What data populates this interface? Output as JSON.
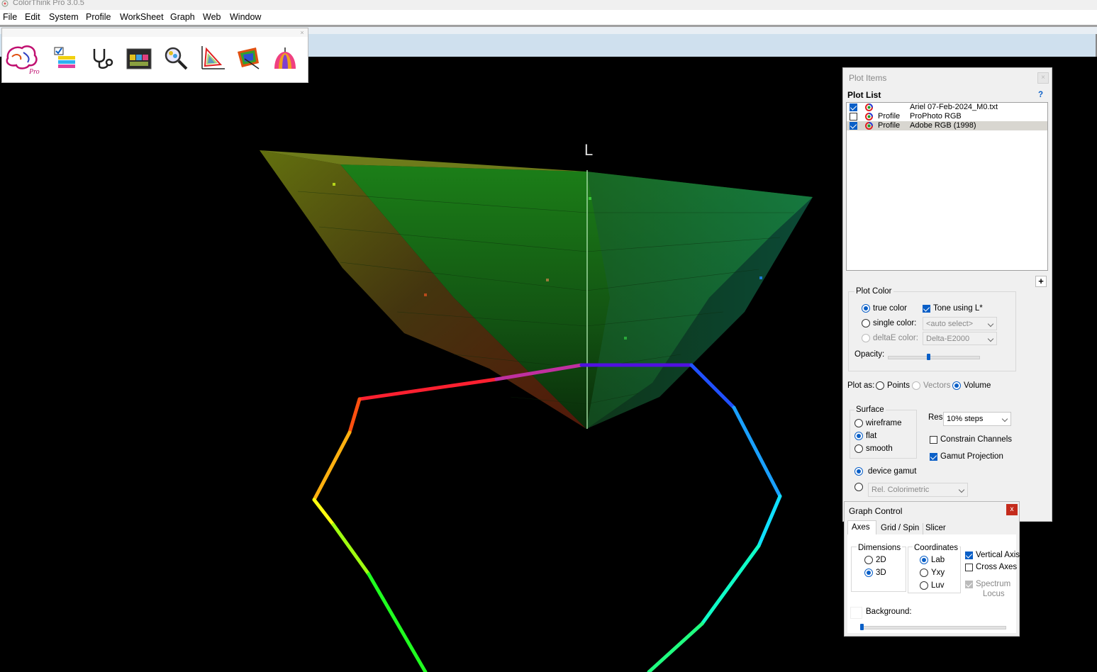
{
  "app": {
    "title": "ColorThink Pro 3.0.5"
  },
  "menu": [
    "File",
    "Edit",
    "System",
    "Profile",
    "WorkSheet",
    "Graph",
    "Web",
    "Window"
  ],
  "toolbar": {
    "icons": [
      "colorthink-pro-logo-icon",
      "worksheet-icon",
      "profile-inspector-icon",
      "color-worksheet-icon",
      "profile-info-icon",
      "gamut-graph-icon",
      "device-link-icon",
      "profile-renderer-icon"
    ]
  },
  "graph": {
    "axis_label": "L"
  },
  "plot_items": {
    "title": "Plot Items",
    "close": "×",
    "plot_list_label": "Plot List",
    "help": "?",
    "items": [
      {
        "checked": true,
        "type": "",
        "name": "Ariel 07-Feb-2024_M0.txt",
        "selected": false
      },
      {
        "checked": false,
        "type": "Profile",
        "name": "ProPhoto RGB",
        "selected": false
      },
      {
        "checked": true,
        "type": "Profile",
        "name": "Adobe RGB (1998)",
        "selected": true
      }
    ],
    "add_button": "+",
    "plot_color": {
      "label": "Plot Color",
      "true_color": "true color",
      "single_color": "single color:",
      "delta_e_color": "deltaE color:",
      "tone_using_l": "Tone using L*",
      "auto_select": "<auto select>",
      "delta_e_mode": "Delta-E2000",
      "opacity": "Opacity:",
      "opacity_value": 0.45
    },
    "plot_as": {
      "label": "Plot as:",
      "points": "Points",
      "vectors": "Vectors",
      "volume": "Volume"
    },
    "surface": {
      "label": "Surface",
      "wireframe": "wireframe",
      "flat": "flat",
      "smooth": "smooth"
    },
    "res": {
      "label": "Res:",
      "value": "10% steps"
    },
    "constrain_channels": "Constrain Channels",
    "gamut_projection": "Gamut Projection",
    "device_gamut": "device gamut",
    "rendering_intent": "Rel. Colorimetric"
  },
  "graph_control": {
    "title": "Graph Control",
    "close": "x",
    "tabs": [
      "Axes",
      "Grid / Spin",
      "Slicer"
    ],
    "dimensions": {
      "label": "Dimensions",
      "d2": "2D",
      "d3": "3D"
    },
    "coordinates": {
      "label": "Coordinates",
      "lab": "Lab",
      "yxy": "Yxy",
      "luv": "Luv"
    },
    "vertical_axis": "Vertical Axis",
    "cross_axes": "Cross Axes",
    "spectrum_locus_1": "Spectrum",
    "spectrum_locus_2": "Locus",
    "background": "Background:",
    "background_value": 0
  }
}
